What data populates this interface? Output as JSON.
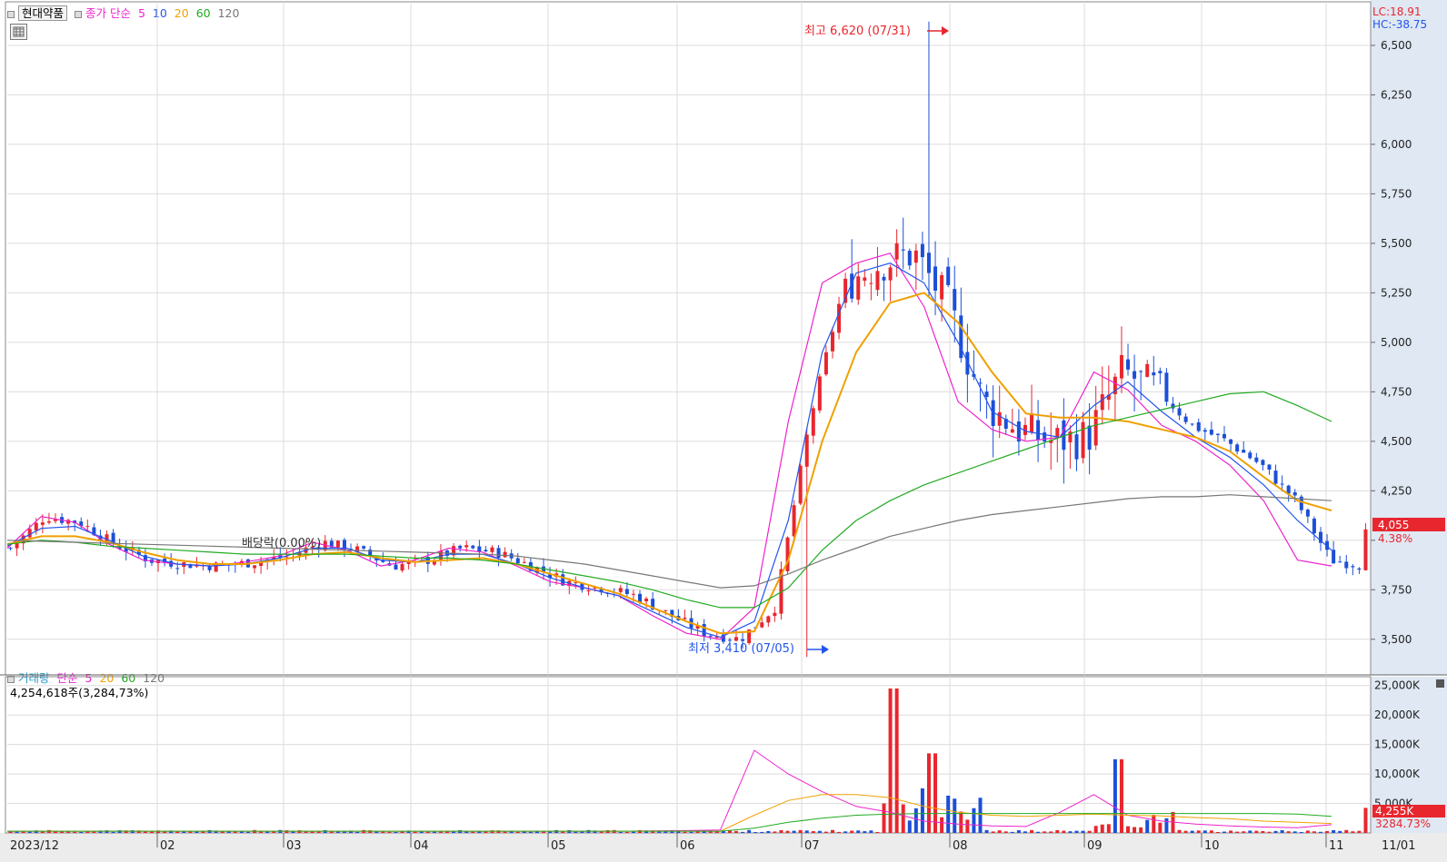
{
  "header": {
    "stock_name": "현대약품",
    "ma_label": "종가 단순",
    "ma_periods": [
      "5",
      "10",
      "20",
      "60",
      "120"
    ],
    "ma_colors": [
      "#ee22cc",
      "#2255ee",
      "#f0a000",
      "#22aa22",
      "#777777"
    ],
    "lc": "LC:18.91",
    "hc": "HC:-38.75"
  },
  "volume_header": {
    "label": "거래량",
    "ma_label": "단순",
    "ma_periods": [
      "5",
      "20",
      "60",
      "120"
    ],
    "ma_colors": [
      "#ee22cc",
      "#f0a000",
      "#22aa22",
      "#777777"
    ],
    "value_text": "4,254,618주(3,284,73%)"
  },
  "annotations": {
    "high": "최고 6,620 (07/31)",
    "low": "최저 3,410 (07/05)",
    "dividend": "배당락(0.00%)"
  },
  "price_tags": {
    "current": "4,055",
    "change": "4.38%",
    "volume_current": "4,255K",
    "volume_ratio": "3284.73%"
  },
  "colors": {
    "up": "#e8262e",
    "down": "#1c4fd8",
    "axis_bg": "#dfe8f3",
    "tag_bg": "#e8262e"
  },
  "chart_data": [
    {
      "type": "candlestick",
      "title": "현대약품",
      "y_ticks": [
        3500,
        3750,
        4000,
        4250,
        4500,
        4750,
        5000,
        5250,
        5500,
        5750,
        6000,
        6250,
        6500
      ],
      "y_tick_labels": [
        "3,500",
        "3,750",
        "",
        "4,250",
        "4,500",
        "4,750",
        "5,000",
        "5,250",
        "5,500",
        "5,750",
        "6,000",
        "6,250",
        "6,500"
      ],
      "ylim": [
        3320,
        6720
      ],
      "x_tick_labels": [
        "2023/12",
        "02",
        "03",
        "04",
        "05",
        "06",
        "07",
        "08",
        "09",
        "10",
        "11",
        "11/01"
      ],
      "high": {
        "value": 6620,
        "date": "07/31"
      },
      "low": {
        "value": 3410,
        "date": "07/05"
      },
      "last_close": 4055,
      "series": [
        {
          "name": "5",
          "values": [
            3960,
            4120,
            4090,
            3980,
            3900,
            3880,
            3870,
            3890,
            3920,
            3990,
            3950,
            3870,
            3900,
            3960,
            3940,
            3870,
            3790,
            3760,
            3720,
            3620,
            3530,
            3500,
            3660,
            4600,
            5300,
            5400,
            5450,
            5180,
            4700,
            4560,
            4500,
            4520,
            4850,
            4760,
            4580,
            4500,
            4380,
            4200,
            3900,
            3870
          ]
        },
        {
          "name": "10",
          "values": [
            3970,
            4060,
            4070,
            4000,
            3920,
            3880,
            3870,
            3880,
            3910,
            3960,
            3960,
            3900,
            3890,
            3930,
            3930,
            3880,
            3810,
            3760,
            3720,
            3640,
            3560,
            3510,
            3590,
            4100,
            4950,
            5350,
            5400,
            5300,
            5000,
            4650,
            4550,
            4520,
            4680,
            4800,
            4650,
            4520,
            4420,
            4280,
            4100,
            3950
          ]
        },
        {
          "name": "20",
          "values": [
            3980,
            4020,
            4020,
            3990,
            3940,
            3900,
            3880,
            3880,
            3900,
            3930,
            3940,
            3910,
            3890,
            3900,
            3910,
            3880,
            3830,
            3780,
            3730,
            3660,
            3590,
            3530,
            3540,
            3900,
            4500,
            4950,
            5200,
            5250,
            5100,
            4850,
            4640,
            4620,
            4620,
            4600,
            4560,
            4520,
            4450,
            4320,
            4200,
            4150
          ]
        },
        {
          "name": "60",
          "values": [
            3980,
            4000,
            3990,
            3970,
            3960,
            3950,
            3940,
            3930,
            3930,
            3930,
            3930,
            3920,
            3910,
            3910,
            3900,
            3880,
            3850,
            3820,
            3790,
            3750,
            3700,
            3660,
            3660,
            3760,
            3950,
            4100,
            4200,
            4280,
            4340,
            4400,
            4460,
            4520,
            4580,
            4620,
            4660,
            4700,
            4740,
            4750,
            4680,
            4600
          ]
        },
        {
          "name": "120",
          "values": [
            4000,
            3995,
            3990,
            3985,
            3980,
            3975,
            3970,
            3965,
            3960,
            3955,
            3950,
            3945,
            3940,
            3935,
            3930,
            3920,
            3900,
            3880,
            3850,
            3820,
            3790,
            3760,
            3770,
            3830,
            3900,
            3960,
            4020,
            4060,
            4100,
            4130,
            4150,
            4170,
            4190,
            4210,
            4220,
            4220,
            4230,
            4220,
            4210,
            4200
          ]
        }
      ]
    },
    {
      "type": "bar",
      "title": "거래량",
      "y_tick_labels": [
        "5,000K",
        "10,000K",
        "15,000K",
        "20,000K",
        "25,000K"
      ],
      "y_ticks": [
        5000,
        10000,
        15000,
        20000,
        25000
      ],
      "ylim": [
        0,
        26500
      ],
      "unit": "K",
      "last_volume": 4255
    }
  ]
}
